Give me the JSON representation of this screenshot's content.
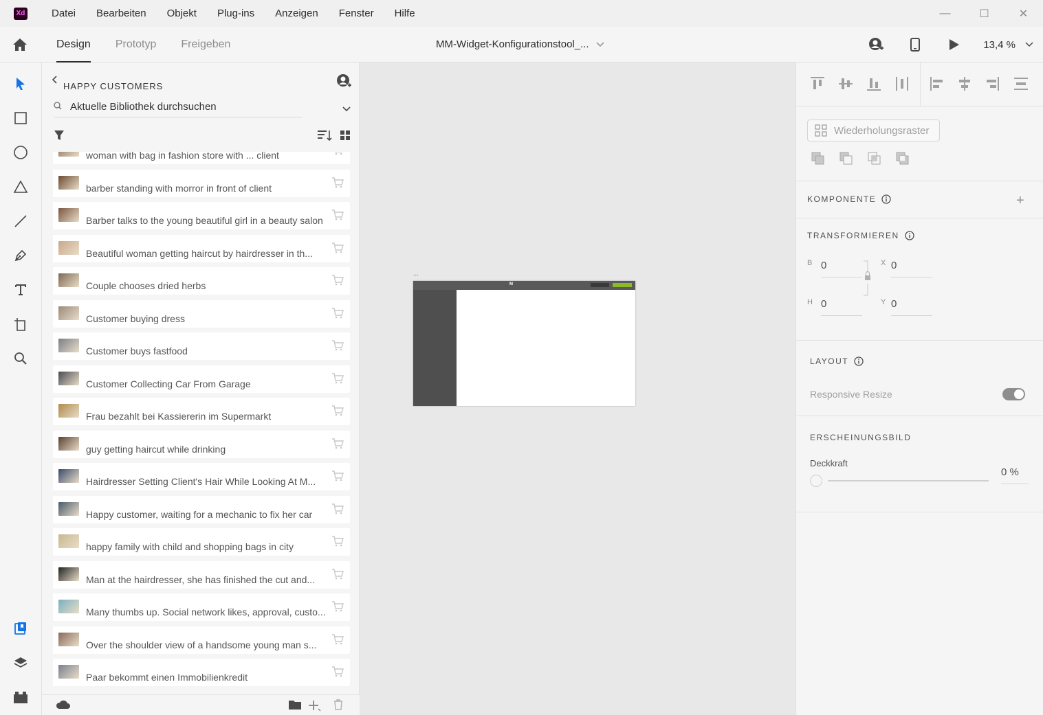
{
  "app": {
    "logo_text": "Xd",
    "accent": "#ff61f6"
  },
  "menu": [
    "Datei",
    "Bearbeiten",
    "Objekt",
    "Plug-ins",
    "Anzeigen",
    "Fenster",
    "Hilfe"
  ],
  "window_controls": {
    "minimize": "—",
    "maximize": "☐",
    "close": "✕"
  },
  "tabs": [
    {
      "label": "Design",
      "active": true
    },
    {
      "label": "Prototyp",
      "active": false
    },
    {
      "label": "Freigeben",
      "active": false
    }
  ],
  "document": {
    "title": "MM-Widget-Konfigurationstool_..."
  },
  "zoom": {
    "value": "13,4 %"
  },
  "library": {
    "title": "HAPPY CUSTOMERS",
    "search_placeholder": "Aktuelle Bibliothek durchsuchen",
    "items": [
      {
        "name": "woman with bag in fashion store with ... client",
        "thumb": "#8a6e55"
      },
      {
        "name": "barber standing with morror in front of client",
        "thumb": "#6b4a30"
      },
      {
        "name": "Barber talks to the young beautiful girl in a beauty salon",
        "thumb": "#7a5540"
      },
      {
        "name": "Beautiful woman getting haircut by hairdresser in th...",
        "thumb": "#c9a88a"
      },
      {
        "name": "Couple chooses dried herbs",
        "thumb": "#7d6a52"
      },
      {
        "name": "Customer buying dress",
        "thumb": "#9a8a7a"
      },
      {
        "name": "Customer buys fastfood",
        "thumb": "#7b7f86"
      },
      {
        "name": "Customer Collecting Car From Garage",
        "thumb": "#4a4a52"
      },
      {
        "name": "Frau bezahlt bei Kassiererin im Supermarkt",
        "thumb": "#b08a4a"
      },
      {
        "name": "guy getting haircut while drinking",
        "thumb": "#5a4030"
      },
      {
        "name": "Hairdresser Setting Client's Hair While Looking At M...",
        "thumb": "#3a4a6a"
      },
      {
        "name": "Happy customer, waiting for a mechanic to fix her car",
        "thumb": "#4a5a6a"
      },
      {
        "name": "happy family with child and shopping bags in city",
        "thumb": "#c8b890"
      },
      {
        "name": "Man at the hairdresser, she has finished the cut and...",
        "thumb": "#222222"
      },
      {
        "name": "Many thumbs up. Social network likes, approval, custo...",
        "thumb": "#7ab0c0"
      },
      {
        "name": "Over the shoulder view of a handsome young man s...",
        "thumb": "#8a6a5a"
      },
      {
        "name": "Paar bekommt einen Immobilienkredit",
        "thumb": "#7a8090"
      }
    ]
  },
  "artboard": {
    "label": "...",
    "logo_text": "M",
    "btn_color_1": "#3a3a3a",
    "btn_color_2": "#8cb928"
  },
  "properties": {
    "repeat_grid": "Wiederholungsraster",
    "component_title": "KOMPONENTE",
    "transform_title": "TRANSFORMIEREN",
    "transform": {
      "w_label": "B",
      "w_value": "0",
      "x_label": "X",
      "x_value": "0",
      "h_label": "H",
      "h_value": "0",
      "y_label": "Y",
      "y_value": "0"
    },
    "layout_title": "LAYOUT",
    "responsive_resize": "Responsive Resize",
    "appearance_title": "ERSCHEINUNGSBILD",
    "opacity_label": "Deckkraft",
    "opacity_value": "0 %"
  }
}
